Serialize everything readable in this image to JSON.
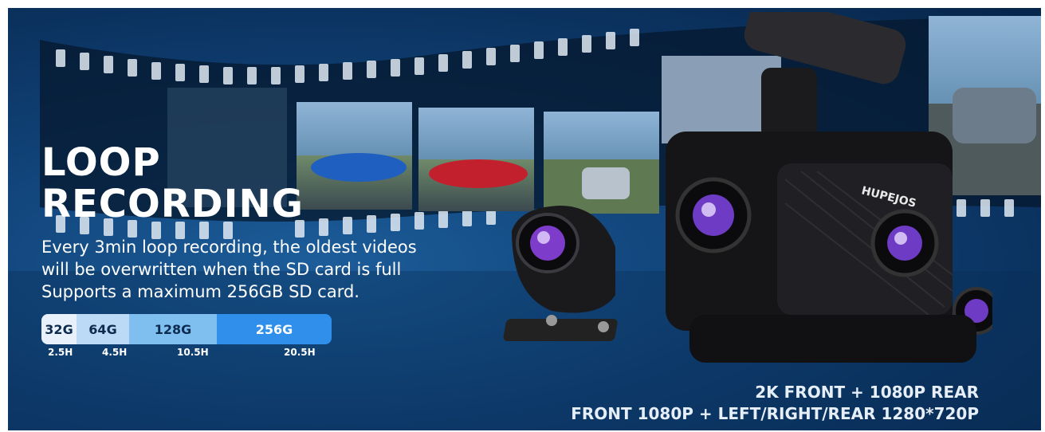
{
  "headline": {
    "line1": "LOOP",
    "line2": "RECORDING"
  },
  "description": {
    "line1": "Every 3min loop recording, the oldest videos",
    "line2": "will be overwritten when the SD card is full",
    "line3": "Supports a maximum 256GB SD card."
  },
  "capacity": [
    {
      "size": "32G",
      "hours": "2.5H",
      "color": "#e8f1fb"
    },
    {
      "size": "64G",
      "hours": "4.5H",
      "color": "#bcd9f6"
    },
    {
      "size": "128G",
      "hours": "10.5H",
      "color": "#7fbff0"
    },
    {
      "size": "256G",
      "hours": "20.5H",
      "color": "#2f8fea"
    }
  ],
  "product": {
    "brand": "HUPEJOS"
  },
  "specs": {
    "line1": "2K FRONT + 1080P REAR",
    "line2": "FRONT 1080P + LEFT/RIGHT/REAR 1280*720P"
  },
  "colors": {
    "background": "#0f3f73",
    "accent": "#2f8fea",
    "text": "#ffffff"
  }
}
